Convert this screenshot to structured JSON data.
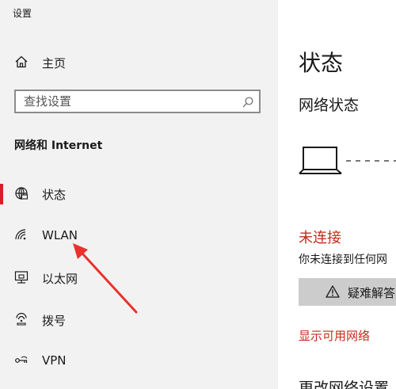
{
  "window": {
    "title": "设置"
  },
  "sidebar": {
    "home_label": "主页",
    "search_placeholder": "查找设置",
    "section_heading": "网络和 Internet",
    "items": [
      {
        "label": "状态",
        "icon": "globe-icon",
        "selected": true
      },
      {
        "label": "WLAN",
        "icon": "wifi-icon",
        "selected": false
      },
      {
        "label": "以太网",
        "icon": "ethernet-icon",
        "selected": false
      },
      {
        "label": "拨号",
        "icon": "dialup-icon",
        "selected": false
      },
      {
        "label": "VPN",
        "icon": "vpn-icon",
        "selected": false
      }
    ]
  },
  "main": {
    "heading": "状态",
    "subheading": "网络状态",
    "status": "未连接",
    "status_description": "你未连接到任何网",
    "troubleshoot_label": "疑难解答",
    "show_networks_link": "显示可用网络",
    "next_heading": "更改网络设置"
  },
  "colors": {
    "accent_red": "#c42b1c",
    "selection_bar": "#d81e26",
    "sidebar_bg": "#f2f2f2",
    "annotation_arrow": "#e8322b"
  },
  "annotation": {
    "type": "arrow",
    "target": "WLAN"
  }
}
